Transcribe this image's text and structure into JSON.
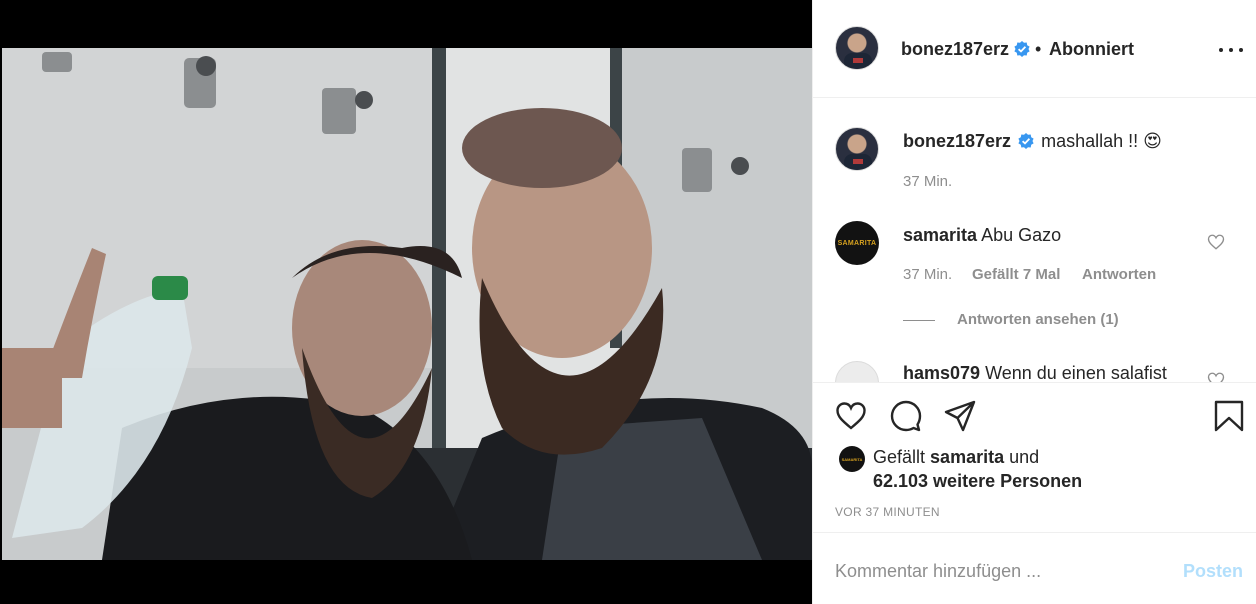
{
  "post": {
    "username": "bonez187erz",
    "separator": "•",
    "follow_status": "Abonniert",
    "caption": "mashallah !!",
    "caption_emoji": "😍",
    "caption_time": "37 Min."
  },
  "comments": [
    {
      "username": "samarita",
      "text": "Abu Gazo",
      "time": "37 Min.",
      "likes": "Gefällt 7 Mal",
      "reply_label": "Antworten",
      "view_replies": "Antworten ansehen (1)",
      "avatar_text": "SAMARITA"
    },
    {
      "username": "hams079",
      "text": "Wenn du einen salafist"
    }
  ],
  "likes": {
    "prefix": "Gefällt",
    "user": "samarita",
    "connector": "und",
    "others": "62.103 weitere Personen",
    "avatar_text": "SAMARITA"
  },
  "timestamp_upper": "VOR 37 MINUTEN",
  "add_comment": {
    "placeholder": "Kommentar hinzufügen ...",
    "post_label": "Posten"
  },
  "colors": {
    "verified": "#3897f0",
    "post_disabled": "#b2dffc",
    "muted": "#8e8e8e"
  },
  "icons": [
    "verified-badge-icon",
    "more-options-icon",
    "heart-icon",
    "comment-icon",
    "share-icon",
    "bookmark-icon"
  ]
}
